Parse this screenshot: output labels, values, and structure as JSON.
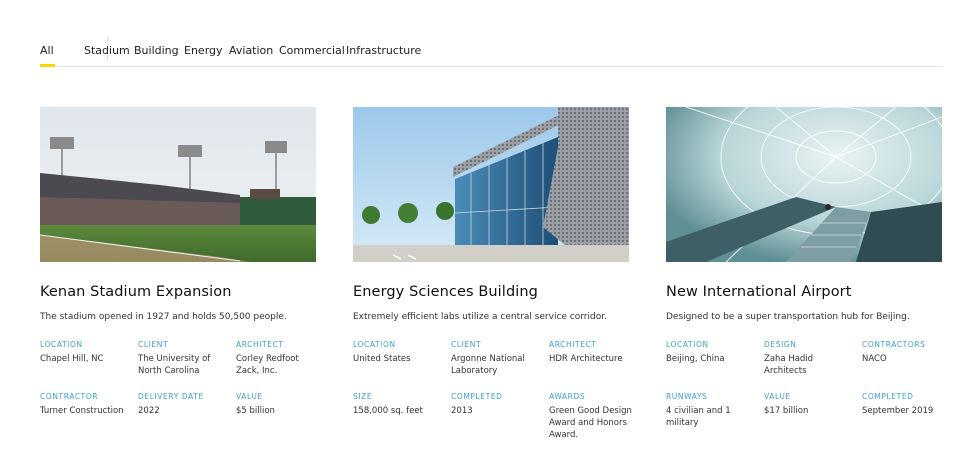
{
  "filters": [
    "All",
    "Stadium",
    "Building",
    "Energy",
    "Aviation",
    "Commercial",
    "Infrastructure"
  ],
  "active_filter": "All",
  "accent_color": "#f5d800",
  "label_color": "#3aa0d6",
  "projects": [
    {
      "title": "Kenan Stadium Expansion",
      "description": "The stadium opened in 1927 and holds 50,500 people.",
      "image_icon": "stadium-photo",
      "details": [
        {
          "label": "LOCATION",
          "value": "Chapel Hill, NC"
        },
        {
          "label": "CLIENT",
          "value": "The University of North Carolina"
        },
        {
          "label": "ARCHITECT",
          "value": "Corley Redfoot Zack, Inc."
        },
        {
          "label": "CONTRACTOR",
          "value": "Turner Construction"
        },
        {
          "label": "DELIVERY DATE",
          "value": "2022"
        },
        {
          "label": "VALUE",
          "value": "$5 billion"
        }
      ]
    },
    {
      "title": "Energy Sciences Building",
      "description": "Extremely efficient labs utilize a central service corridor.",
      "image_icon": "building-photo",
      "details": [
        {
          "label": "LOCATION",
          "value": "United States"
        },
        {
          "label": "CLIENT",
          "value": "Argonne National Laboratory"
        },
        {
          "label": "ARCHITECT",
          "value": "HDR Architecture"
        },
        {
          "label": "SIZE",
          "value": "158,000 sq. feet"
        },
        {
          "label": "COMPLETED",
          "value": "2013"
        },
        {
          "label": "AWARDS",
          "value": "Green Good Design Award and Honors Award."
        }
      ]
    },
    {
      "title": "New International Airport",
      "description": "Designed to be a super transportation hub for Beijing.",
      "image_icon": "airport-photo",
      "details": [
        {
          "label": "LOCATION",
          "value": "Beijing, China"
        },
        {
          "label": "DESIGN",
          "value": "Zaha Hadid Architects"
        },
        {
          "label": "CONTRACTORS",
          "value": "NACO"
        },
        {
          "label": "RUNWAYS",
          "value": "4 civilian and 1 military"
        },
        {
          "label": "VALUE",
          "value": "$17 billion"
        },
        {
          "label": "COMPLETED",
          "value": "September 2019"
        }
      ]
    }
  ]
}
